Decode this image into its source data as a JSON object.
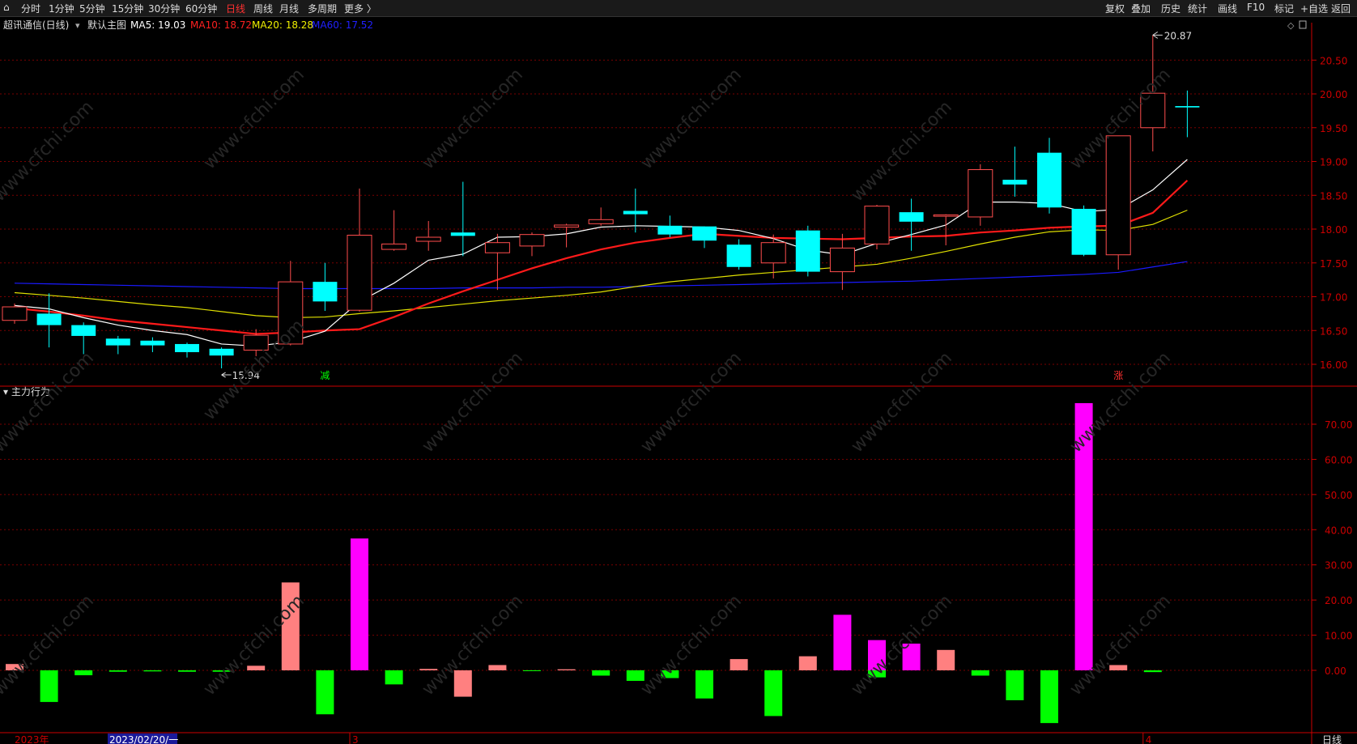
{
  "toolbar": {
    "left": [
      {
        "label": "分时"
      },
      {
        "label": "1分钟"
      },
      {
        "label": "5分钟"
      },
      {
        "label": "15分钟"
      },
      {
        "label": "30分钟"
      },
      {
        "label": "60分钟"
      },
      {
        "label": "日线",
        "active": true
      },
      {
        "label": "周线"
      },
      {
        "label": "月线"
      },
      {
        "label": "多周期"
      },
      {
        "label": "更多 〉"
      }
    ],
    "right": [
      {
        "label": "复权"
      },
      {
        "label": "叠加"
      },
      {
        "label": "历史"
      },
      {
        "label": "统计"
      },
      {
        "label": "画线"
      },
      {
        "label": "F10"
      },
      {
        "label": "标记"
      },
      {
        "label": "+自选"
      },
      {
        "label": "返回"
      }
    ]
  },
  "main_chart": {
    "title": "超讯通信(日线)",
    "indicator_name": "默认主图",
    "ma_labels": [
      {
        "text": "MA5: 19.03",
        "color": "#ffffff"
      },
      {
        "text": "MA10: 18.72",
        "color": "#ff2020"
      },
      {
        "text": "MA20: 18.28",
        "color": "#f0f000"
      },
      {
        "text": "MA60: 17.52",
        "color": "#2020ff"
      }
    ],
    "high_marker": "20.87",
    "low_marker": "15.94",
    "signal_labels": [
      {
        "text": "减",
        "index": 9,
        "color": "#00ff00"
      },
      {
        "text": "涨",
        "index": 32,
        "color": "#ff3030"
      }
    ]
  },
  "sub_chart": {
    "title": "主力行为"
  },
  "bottom_axis": {
    "year_label": "2023年",
    "cursor_date": "2023/02/20/一",
    "month_marks": [
      {
        "text": "3",
        "index": 10
      },
      {
        "text": "4",
        "index": 33
      }
    ],
    "period": "日线"
  },
  "colors": {
    "up": "#ff4d4d",
    "down": "#00ffff",
    "ma5": "#ffffff",
    "ma10": "#ff1a1a",
    "ma20": "#e0e000",
    "ma60": "#1a1aff",
    "grid": "#7a0000",
    "axis": "#cc0000",
    "big_pos": "#ff00ff",
    "pos": "#ff8080",
    "neg": "#00ff00"
  },
  "chart_data": [
    {
      "type": "candlestick",
      "title": "超讯通信(日线)",
      "y_ticks": [
        16.0,
        16.5,
        17.0,
        17.5,
        18.0,
        18.5,
        19.0,
        19.5,
        20.0,
        20.5
      ],
      "ylim": [
        15.8,
        21.3
      ],
      "candles": [
        {
          "o": 16.65,
          "h": 16.9,
          "l": 16.6,
          "c": 16.85
        },
        {
          "o": 16.75,
          "h": 17.05,
          "l": 16.25,
          "c": 16.58
        },
        {
          "o": 16.58,
          "h": 16.62,
          "l": 16.15,
          "c": 16.42
        },
        {
          "o": 16.38,
          "h": 16.42,
          "l": 16.15,
          "c": 16.28
        },
        {
          "o": 16.35,
          "h": 16.4,
          "l": 16.18,
          "c": 16.28
        },
        {
          "o": 16.3,
          "h": 16.32,
          "l": 16.1,
          "c": 16.18
        },
        {
          "o": 16.23,
          "h": 16.25,
          "l": 15.94,
          "c": 16.13
        },
        {
          "o": 16.21,
          "h": 16.52,
          "l": 16.12,
          "c": 16.43
        },
        {
          "o": 16.3,
          "h": 17.53,
          "l": 16.28,
          "c": 17.22
        },
        {
          "o": 17.22,
          "h": 17.5,
          "l": 16.79,
          "c": 16.93
        },
        {
          "o": 16.8,
          "h": 18.6,
          "l": 16.78,
          "c": 17.91
        },
        {
          "o": 17.7,
          "h": 18.28,
          "l": 17.68,
          "c": 17.78
        },
        {
          "o": 17.82,
          "h": 18.12,
          "l": 17.68,
          "c": 17.88
        },
        {
          "o": 17.95,
          "h": 18.7,
          "l": 17.6,
          "c": 17.9
        },
        {
          "o": 17.65,
          "h": 17.93,
          "l": 17.1,
          "c": 17.8
        },
        {
          "o": 17.75,
          "h": 17.95,
          "l": 17.6,
          "c": 17.92
        },
        {
          "o": 18.03,
          "h": 18.08,
          "l": 17.73,
          "c": 18.06
        },
        {
          "o": 18.08,
          "h": 18.32,
          "l": 18.05,
          "c": 18.14
        },
        {
          "o": 18.27,
          "h": 18.6,
          "l": 17.95,
          "c": 18.22
        },
        {
          "o": 18.05,
          "h": 18.2,
          "l": 17.88,
          "c": 17.92
        },
        {
          "o": 18.04,
          "h": 18.04,
          "l": 17.72,
          "c": 17.83
        },
        {
          "o": 17.77,
          "h": 17.85,
          "l": 17.4,
          "c": 17.44
        },
        {
          "o": 17.5,
          "h": 17.92,
          "l": 17.27,
          "c": 17.8
        },
        {
          "o": 17.98,
          "h": 18.05,
          "l": 17.3,
          "c": 17.37
        },
        {
          "o": 17.37,
          "h": 17.93,
          "l": 17.1,
          "c": 17.72
        },
        {
          "o": 17.78,
          "h": 18.36,
          "l": 17.7,
          "c": 18.34
        },
        {
          "o": 18.25,
          "h": 18.45,
          "l": 17.68,
          "c": 18.11
        },
        {
          "o": 18.19,
          "h": 18.22,
          "l": 17.76,
          "c": 18.21
        },
        {
          "o": 18.18,
          "h": 18.96,
          "l": 18.05,
          "c": 18.88
        },
        {
          "o": 18.73,
          "h": 19.22,
          "l": 18.48,
          "c": 18.66
        },
        {
          "o": 19.13,
          "h": 19.35,
          "l": 18.23,
          "c": 18.32
        },
        {
          "o": 18.3,
          "h": 18.35,
          "l": 17.6,
          "c": 17.62
        },
        {
          "o": 17.62,
          "h": 19.38,
          "l": 17.4,
          "c": 19.38
        },
        {
          "o": 19.5,
          "h": 20.87,
          "l": 19.15,
          "c": 20.01
        },
        {
          "o": 19.82,
          "h": 20.05,
          "l": 19.36,
          "c": 19.8
        }
      ],
      "ma5": [
        16.87,
        16.82,
        16.69,
        16.58,
        16.5,
        16.44,
        16.3,
        16.27,
        16.33,
        16.49,
        16.93,
        17.2,
        17.54,
        17.63,
        17.88,
        17.89,
        17.93,
        18.03,
        18.05,
        18.04,
        18.03,
        17.98,
        17.86,
        17.69,
        17.62,
        17.79,
        17.92,
        18.06,
        18.4,
        18.4,
        18.38,
        18.26,
        18.29,
        18.58,
        19.03
      ],
      "ma10": [
        16.83,
        16.78,
        16.72,
        16.65,
        16.6,
        16.55,
        16.5,
        16.45,
        16.47,
        16.5,
        16.52,
        16.7,
        16.9,
        17.08,
        17.25,
        17.42,
        17.57,
        17.7,
        17.8,
        17.87,
        17.93,
        17.9,
        17.87,
        17.86,
        17.85,
        17.87,
        17.89,
        17.9,
        17.95,
        17.98,
        18.02,
        18.04,
        18.05,
        18.24,
        18.72
      ],
      "ma20": [
        17.06,
        17.02,
        16.98,
        16.93,
        16.88,
        16.84,
        16.78,
        16.72,
        16.69,
        16.7,
        16.75,
        16.79,
        16.84,
        16.89,
        16.94,
        16.98,
        17.02,
        17.07,
        17.15,
        17.22,
        17.27,
        17.32,
        17.36,
        17.4,
        17.44,
        17.48,
        17.57,
        17.67,
        17.78,
        17.88,
        17.96,
        17.99,
        17.98,
        18.07,
        18.28
      ],
      "ma60": [
        17.2,
        17.19,
        17.18,
        17.17,
        17.16,
        17.15,
        17.14,
        17.13,
        17.12,
        17.12,
        17.12,
        17.12,
        17.12,
        17.13,
        17.13,
        17.13,
        17.14,
        17.14,
        17.15,
        17.16,
        17.17,
        17.18,
        17.19,
        17.2,
        17.21,
        17.22,
        17.23,
        17.25,
        17.27,
        17.29,
        17.31,
        17.33,
        17.36,
        17.44,
        17.52
      ]
    },
    {
      "type": "bar",
      "title": "主力行为",
      "y_ticks": [
        0,
        10,
        20,
        30,
        40,
        50,
        60,
        70
      ],
      "ylim": [
        -16,
        79
      ],
      "values": [
        1.8,
        -9.0,
        -1.4,
        -0.4,
        -0.3,
        -0.4,
        -0.4,
        1.3,
        25.0,
        -12.5,
        37.5,
        -4.0,
        0.4,
        -7.5,
        1.5,
        -0.2,
        0.3,
        -1.5,
        -3.0,
        -2.2,
        -8.0,
        3.2,
        -13.0,
        4.0,
        15.8,
        8.6,
        7.6,
        5.8,
        -1.5,
        -8.5,
        -15.0,
        76.0,
        1.5,
        -0.5
      ],
      "flags": [
        null,
        null,
        null,
        null,
        null,
        null,
        null,
        null,
        null,
        null,
        "big",
        null,
        null,
        "doubleup",
        null,
        null,
        null,
        null,
        null,
        null,
        null,
        null,
        null,
        null,
        "big",
        "big_neg",
        "big",
        null,
        null,
        null,
        null,
        "big",
        null,
        null
      ]
    }
  ]
}
